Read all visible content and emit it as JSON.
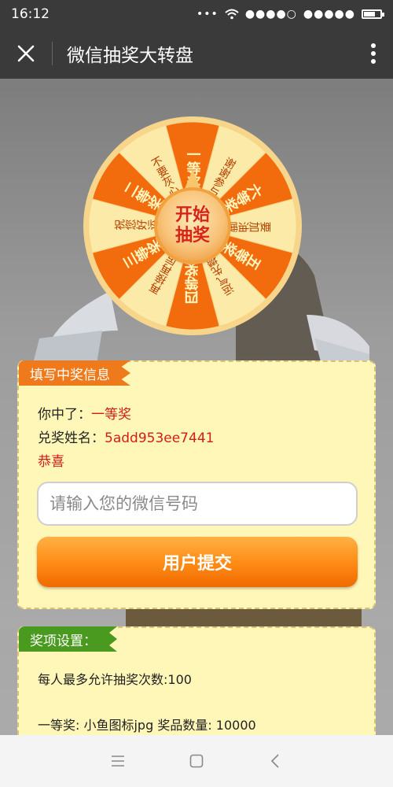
{
  "status": {
    "time": "16:12"
  },
  "header": {
    "title": "微信抽奖大转盘"
  },
  "wheel": {
    "segments": [
      {
        "label": "一等奖",
        "big": true
      },
      {
        "label": "谢谢参与",
        "big": false
      },
      {
        "label": "六等奖",
        "big": true
      },
      {
        "label": "要加油哦",
        "big": false
      },
      {
        "label": "五等奖",
        "big": true
      },
      {
        "label": "运气先攒着",
        "big": false
      },
      {
        "label": "四等奖",
        "big": true
      },
      {
        "label": "再接再厉",
        "big": false
      },
      {
        "label": "三等奖",
        "big": true
      },
      {
        "label": "祝您好运",
        "big": false
      },
      {
        "label": "二等奖",
        "big": true
      },
      {
        "label": "不要灰心",
        "big": false
      }
    ],
    "start_line1": "开始",
    "start_line2": "抽奖",
    "colors": {
      "orange": "#f26c0d",
      "cream": "#fbeaa8",
      "rim": "#f7d58a"
    }
  },
  "info_panel": {
    "tag": "填写中奖信息",
    "won_label": "你中了：",
    "won_value": "一等奖",
    "name_label": "兑奖姓名：",
    "name_value": "5add953ee7441",
    "congrats": "恭喜",
    "input_placeholder": "请输入您的微信号码",
    "submit_label": "用户提交"
  },
  "prize_panel": {
    "tag": "奖项设置：",
    "max_draws": "每人最多允许抽奖次数:100",
    "first_prize": "一等奖: 小鱼图标jpg 奖品数量: 10000"
  },
  "icons": [
    "close-icon",
    "more-icon",
    "wifi-icon",
    "battery-icon",
    "menu-icon",
    "home-icon",
    "back-icon"
  ]
}
